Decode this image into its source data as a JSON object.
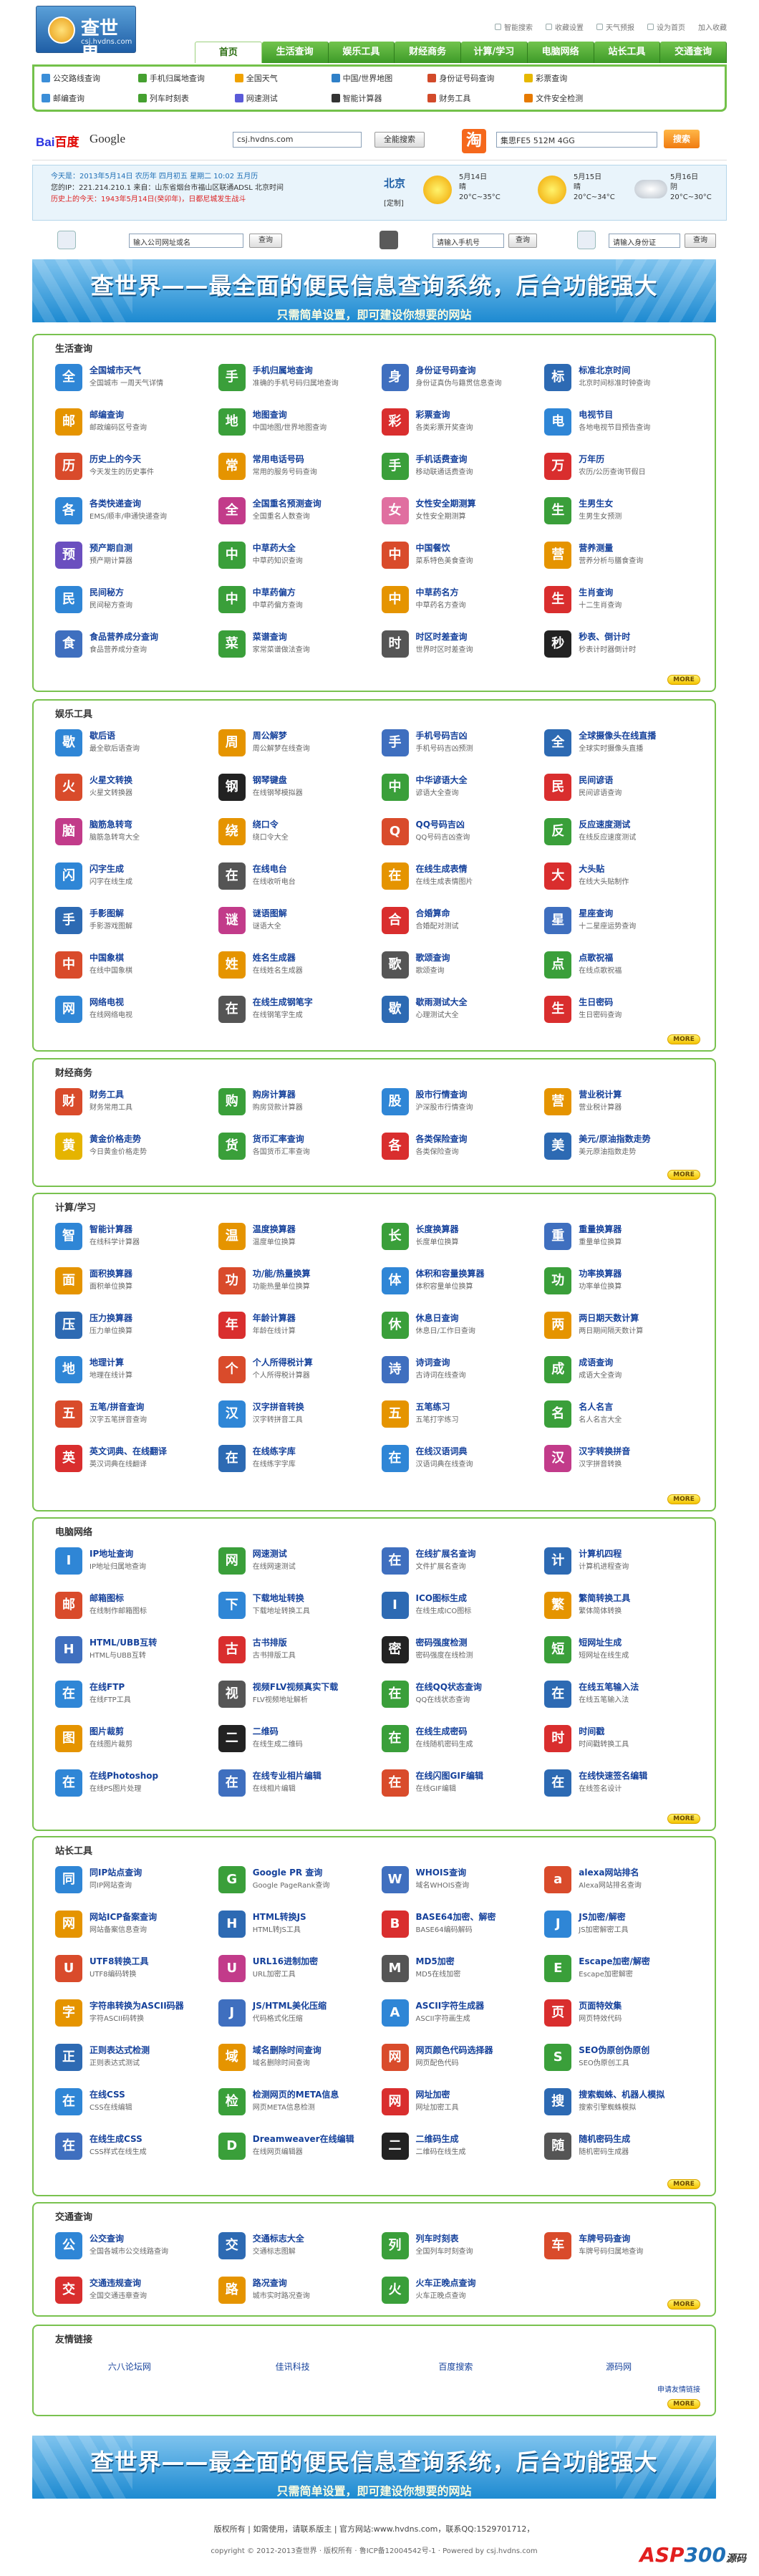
{
  "site": {
    "name": "查世界",
    "url": "csj.hvdns.com"
  },
  "toplinks": [
    "智能搜索",
    "收藏设置",
    "天气预报",
    "设为首页",
    "加入收藏"
  ],
  "nav": [
    "首页",
    "生活查询",
    "娱乐工具",
    "财经商务",
    "计算/学习",
    "电脑网络",
    "站长工具",
    "交通查询"
  ],
  "quick": [
    {
      "label": "公交路线查询",
      "color": "#3b8ed8"
    },
    {
      "label": "手机归属地查询",
      "color": "#45a030"
    },
    {
      "label": "全国天气",
      "color": "#f0a200"
    },
    {
      "label": "中国/世界地图",
      "color": "#2f80c8"
    },
    {
      "label": "身份证号码查询",
      "color": "#d24a2a"
    },
    {
      "label": "彩票查询",
      "color": "#e6b800"
    },
    {
      "label": "",
      "color": "#fff"
    },
    {
      "label": "邮编查询",
      "color": "#3b8ed8"
    },
    {
      "label": "列车时刻表",
      "color": "#45a030"
    },
    {
      "label": "网速测试",
      "color": "#5a5ad8"
    },
    {
      "label": "智能计算器",
      "color": "#333"
    },
    {
      "label": "财务工具",
      "color": "#d24a2a"
    },
    {
      "label": "文件安全检测",
      "color": "#e67a00"
    },
    {
      "label": "",
      "color": "#fff"
    }
  ],
  "search": {
    "baidu": "百度",
    "google": "Google",
    "query": "csj.hvdns.com",
    "button": "全能搜索",
    "taobao_icon": "淘",
    "taobao_value": "集思FE5 512M 4GG",
    "taobao_button": "搜索"
  },
  "info": {
    "line1": "今天是：2013年5月14日 农历年 四月初五 星期二 10:02 五月历",
    "line2": "您的IP：221.214.210.1 来自：山东省烟台市福山区联通ADSL 北京时间",
    "line3": "历史上的今天：1943年5月14日(癸卯年)，日都尼城发生战斗",
    "city": "北京",
    "city_set": "[定制]",
    "weather": [
      {
        "date": "5月14日",
        "cond": "晴",
        "temp": "20°C~35°C",
        "kind": "sun"
      },
      {
        "date": "5月15日",
        "cond": "晴",
        "temp": "20°C~34°C",
        "kind": "sun"
      },
      {
        "date": "5月16日",
        "cond": "阴",
        "temp": "20°C~30°C",
        "kind": "cloud"
      }
    ]
  },
  "sbar": {
    "ph1": "输入公司网址或名",
    "btn1": "查询",
    "ph2": "请输入手机号",
    "btn2": "查询",
    "ph3": "请输入身份证",
    "btn3": "查询"
  },
  "banner": {
    "title": "查世界——最全面的便民信息查询系统，后台功能强大",
    "sub": "只需简单设置，即可建设你想要的网站"
  },
  "more": "MORE",
  "sections": [
    {
      "title": "生活查询",
      "items": [
        [
          "全国城市天气",
          "全国城市 一周天气详情",
          "#2f86d6"
        ],
        [
          "手机归属地查询",
          "准确的手机号码归属地查询",
          "#3a9f3a"
        ],
        [
          "身份证号码查询",
          "身份证真伪与籍贯信息查询",
          "#3f6fbf"
        ],
        [
          "标准北京时间",
          "北京时间标准时钟查询",
          "#2d6ab3"
        ],
        [
          "邮编查询",
          "邮政编码区号查询",
          "#e59400"
        ],
        [
          "地图查询",
          "中国地图/世界地图查询",
          "#3a9f3a"
        ],
        [
          "彩票查询",
          "各类彩票开奖查询",
          "#d92e2e"
        ],
        [
          "电视节目",
          "各地电视节目预告查询",
          "#2f86d6"
        ],
        [
          "历史上的今天",
          "今天发生的历史事件",
          "#d94b2b"
        ],
        [
          "常用电话号码",
          "常用的服务号码查询",
          "#e59400"
        ],
        [
          "手机话费查询",
          "移动联通话费查询",
          "#3a9f3a"
        ],
        [
          "万年历",
          "农历/公历查询节假日",
          "#d92e2e"
        ],
        [
          "各类快递查询",
          "EMS/顺丰/申通快递查询",
          "#2f86d6"
        ],
        [
          "全国重名预测查询",
          "全国重名人数查询",
          "#c23b8a"
        ],
        [
          "女性安全期测算",
          "女性安全期测算",
          "#e06fa0"
        ],
        [
          "生男生女",
          "生男生女预测",
          "#3a9f3a"
        ],
        [
          "预产期自测",
          "预产期计算器",
          "#6b4fbf"
        ],
        [
          "中草药大全",
          "中草药知识查询",
          "#3a9f3a"
        ],
        [
          "中国餐饮",
          "菜系特色美食查询",
          "#d94b2b"
        ],
        [
          "营养测量",
          "营养分析与膳食查询",
          "#e59400"
        ],
        [
          "民间秘方",
          "民间秘方查询",
          "#2f86d6"
        ],
        [
          "中草药偏方",
          "中草药偏方查询",
          "#3a9f3a"
        ],
        [
          "中草药名方",
          "中草药名方查询",
          "#e59400"
        ],
        [
          "生肖查询",
          "十二生肖查询",
          "#d92e2e"
        ],
        [
          "食品营养成分查询",
          "食品营养成分查询",
          "#3f6fbf"
        ],
        [
          "菜谱查询",
          "家常菜谱做法查询",
          "#3a9f3a"
        ],
        [
          "时区时差查询",
          "世界时区时差查询",
          "#555555"
        ],
        [
          "秒表、倒计时",
          "秒表计时器倒计时",
          "#222222"
        ]
      ]
    },
    {
      "title": "娱乐工具",
      "items": [
        [
          "歇后语",
          "最全歇后语查询",
          "#2f86d6"
        ],
        [
          "周公解梦",
          "周公解梦在线查询",
          "#e59400"
        ],
        [
          "手机号码吉凶",
          "手机号码吉凶预测",
          "#3f6fbf"
        ],
        [
          "全球摄像头在线直播",
          "全球实时摄像头直播",
          "#2d6ab3"
        ],
        [
          "火星文转换",
          "火星文转换器",
          "#d94b2b"
        ],
        [
          "钢琴键盘",
          "在线钢琴模拟器",
          "#222222"
        ],
        [
          "中华谚语大全",
          "谚语大全查询",
          "#3a9f3a"
        ],
        [
          "民间谚语",
          "民间谚语查询",
          "#d92e2e"
        ],
        [
          "脑筋急转弯",
          "脑筋急转弯大全",
          "#c23b8a"
        ],
        [
          "绕口令",
          "绕口令大全",
          "#e59400"
        ],
        [
          "QQ号码吉凶",
          "QQ号码吉凶查询",
          "#d94b2b"
        ],
        [
          "反应速度测试",
          "在线反应速度测试",
          "#3a9f3a"
        ],
        [
          "闪字生成",
          "闪字在线生成",
          "#2f86d6"
        ],
        [
          "在线电台",
          "在线收听电台",
          "#555555"
        ],
        [
          "在线生成表情",
          "在线生成表情图片",
          "#e59400"
        ],
        [
          "大头贴",
          "在线大头贴制作",
          "#d92e2e"
        ],
        [
          "手影图解",
          "手影游戏图解",
          "#2d6ab3"
        ],
        [
          "谜语图解",
          "谜语大全",
          "#c23b8a"
        ],
        [
          "合婚算命",
          "合婚配对测试",
          "#d92e2e"
        ],
        [
          "星座查询",
          "十二星座运势查询",
          "#3f6fbf"
        ],
        [
          "中国象棋",
          "在线中国象棋",
          "#d94b2b"
        ],
        [
          "姓名生成器",
          "在线姓名生成器",
          "#e59400"
        ],
        [
          "歌颂查询",
          "歌颂查询",
          "#555555"
        ],
        [
          "点歌祝福",
          "在线点歌祝福",
          "#3a9f3a"
        ],
        [
          "网络电视",
          "在线网络电视",
          "#2f86d6"
        ],
        [
          "在线生成钢笔字",
          "在线钢笔字生成",
          "#555555"
        ],
        [
          "歇雨测试大全",
          "心理测试大全",
          "#2d6ab3"
        ],
        [
          "生日密码",
          "生日密码查询",
          "#d92e2e"
        ]
      ]
    },
    {
      "title": "财经商务",
      "items": [
        [
          "财务工具",
          "财务常用工具",
          "#d94b2b"
        ],
        [
          "购房计算器",
          "购房贷款计算器",
          "#3a9f3a"
        ],
        [
          "股市行情查询",
          "沪深股市行情查询",
          "#2f86d6"
        ],
        [
          "营业税计算",
          "营业税计算器",
          "#e59400"
        ],
        [
          "黄金价格走势",
          "今日黄金价格走势",
          "#e5b400"
        ],
        [
          "货币汇率查询",
          "各国货币汇率查询",
          "#3a9f3a"
        ],
        [
          "各类保险查询",
          "各类保险查询",
          "#d92e2e"
        ],
        [
          "美元/原油指数走势",
          "美元原油指数走势",
          "#2d6ab3"
        ]
      ]
    },
    {
      "title": "计算/学习",
      "items": [
        [
          "智能计算器",
          "在线科学计算器",
          "#2f86d6"
        ],
        [
          "温度换算器",
          "温度单位换算",
          "#e59400"
        ],
        [
          "长度换算器",
          "长度单位换算",
          "#3a9f3a"
        ],
        [
          "重量换算器",
          "重量单位换算",
          "#3f6fbf"
        ],
        [
          "面积换算器",
          "面积单位换算",
          "#e59400"
        ],
        [
          "功/能/热量换算",
          "功能热量单位换算",
          "#d94b2b"
        ],
        [
          "体积和容量换算器",
          "体积容量单位换算",
          "#2f86d6"
        ],
        [
          "功率换算器",
          "功率单位换算",
          "#3a9f3a"
        ],
        [
          "压力换算器",
          "压力单位换算",
          "#2d6ab3"
        ],
        [
          "年龄计算器",
          "年龄在线计算",
          "#d92e2e"
        ],
        [
          "休息日查询",
          "休息日/工作日查询",
          "#3a9f3a"
        ],
        [
          "两日期天数计算",
          "两日期间隔天数计算",
          "#e59400"
        ],
        [
          "地理计算",
          "地理在线计算",
          "#2f86d6"
        ],
        [
          "个人所得税计算",
          "个人所得税计算器",
          "#d94b2b"
        ],
        [
          "诗词查询",
          "古诗词在线查询",
          "#3f6fbf"
        ],
        [
          "成语查询",
          "成语大全查询",
          "#3a9f3a"
        ],
        [
          "五笔/拼音查询",
          "汉字五笔拼音查询",
          "#d94b2b"
        ],
        [
          "汉字拼音转换",
          "汉字转拼音工具",
          "#2f86d6"
        ],
        [
          "五笔练习",
          "五笔打字练习",
          "#e59400"
        ],
        [
          "名人名言",
          "名人名言大全",
          "#3a9f3a"
        ],
        [
          "英文词典、在线翻译",
          "英汉词典在线翻译",
          "#d92e2e"
        ],
        [
          "在线练字库",
          "在线练字字库",
          "#2d6ab3"
        ],
        [
          "在线汉语词典",
          "汉语词典在线查询",
          "#2f86d6"
        ],
        [
          "汉字转换拼音",
          "汉字拼音转换",
          "#c23b8a"
        ]
      ]
    },
    {
      "title": "电脑网络",
      "items": [
        [
          "IP地址查询",
          "IP地址归属地查询",
          "#2f86d6"
        ],
        [
          "网速测试",
          "在线网速测试",
          "#3a9f3a"
        ],
        [
          "在线扩展名查询",
          "文件扩展名查询",
          "#3f6fbf"
        ],
        [
          "计算机四程",
          "计算机进程查询",
          "#2d6ab3"
        ],
        [
          "邮箱图标",
          "在线制作邮箱图标",
          "#d94b2b"
        ],
        [
          "下载地址转换",
          "下载地址转换工具",
          "#2f86d6"
        ],
        [
          "ICO图标生成",
          "在线生成ICO图标",
          "#2d6ab3"
        ],
        [
          "繁简转换工具",
          "繁体简体转换",
          "#e59400"
        ],
        [
          "HTML/UBB互转",
          "HTML与UBB互转",
          "#3f6fbf"
        ],
        [
          "古书排版",
          "古书排版工具",
          "#d92e2e"
        ],
        [
          "密码强度检测",
          "密码强度在线检测",
          "#222222"
        ],
        [
          "短网址生成",
          "短网址在线生成",
          "#3a9f3a"
        ],
        [
          "在线FTP",
          "在线FTP工具",
          "#2f86d6"
        ],
        [
          "视频FLV视频真实下载",
          "FLV视频地址解析",
          "#555555"
        ],
        [
          "在线QQ状态查询",
          "QQ在线状态查询",
          "#3a9f3a"
        ],
        [
          "在线五笔输入法",
          "在线五笔输入法",
          "#2d6ab3"
        ],
        [
          "图片裁剪",
          "在线图片裁剪",
          "#e59400"
        ],
        [
          "二维码",
          "在线生成二维码",
          "#222222"
        ],
        [
          "在线生成密码",
          "在线随机密码生成",
          "#3a9f3a"
        ],
        [
          "时间戳",
          "时间戳转换工具",
          "#d92e2e"
        ],
        [
          "在线Photoshop",
          "在线PS图片处理",
          "#2f86d6"
        ],
        [
          "在线专业相片编辑",
          "在线相片编辑",
          "#3f6fbf"
        ],
        [
          "在线闪图GIF编辑",
          "在线GIF编辑",
          "#d94b2b"
        ],
        [
          "在线快速签名编辑",
          "在线签名设计",
          "#2d6ab3"
        ]
      ]
    },
    {
      "title": "站长工具",
      "items": [
        [
          "同IP站点查询",
          "同IP网站查询",
          "#2f86d6"
        ],
        [
          "Google PR 查询",
          "Google PageRank查询",
          "#3a9f3a"
        ],
        [
          "WHOIS查询",
          "域名WHOIS查询",
          "#3f6fbf"
        ],
        [
          "alexa网站排名",
          "Alexa网站排名查询",
          "#d94b2b"
        ],
        [
          "网站ICP备案查询",
          "网站备案信息查询",
          "#e59400"
        ],
        [
          "HTML转换JS",
          "HTML转JS工具",
          "#2d6ab3"
        ],
        [
          "BASE64加密、解密",
          "BASE64编码解码",
          "#d92e2e"
        ],
        [
          "JS加密/解密",
          "JS加密解密工具",
          "#2f86d6"
        ],
        [
          "UTF8转换工具",
          "UTF8编码转换",
          "#d94b2b"
        ],
        [
          "URL16进制加密",
          "URL加密工具",
          "#c23b8a"
        ],
        [
          "MD5加密",
          "MD5在线加密",
          "#555555"
        ],
        [
          "Escape加密/解密",
          "Escape加密解密",
          "#3a9f3a"
        ],
        [
          "字符串转换为ASCII码器",
          "字符ASCII码转换",
          "#e59400"
        ],
        [
          "JS/HTML美化压缩",
          "代码格式化压缩",
          "#3f6fbf"
        ],
        [
          "ASCII字符生成器",
          "ASCII字符画生成",
          "#2f86d6"
        ],
        [
          "页面特效集",
          "网页特效代码",
          "#d92e2e"
        ],
        [
          "正则表达式检测",
          "正则表达式测试",
          "#2d6ab3"
        ],
        [
          "域名删除时间查询",
          "域名删除时间查询",
          "#e59400"
        ],
        [
          "网页颜色代码选择器",
          "网页配色代码",
          "#d94b2b"
        ],
        [
          "SEO伪原创伪原创",
          "SEO伪原创工具",
          "#3a9f3a"
        ],
        [
          "在线CSS",
          "CSS在线编辑",
          "#2f86d6"
        ],
        [
          "检测网页的META信息",
          "网页META信息检测",
          "#3a9f3a"
        ],
        [
          "网址加密",
          "网址加密工具",
          "#d92e2e"
        ],
        [
          "搜索蜘蛛、机器人模拟",
          "搜索引擎蜘蛛模拟",
          "#2d6ab3"
        ],
        [
          "在线生成CSS",
          "CSS样式在线生成",
          "#3f6fbf"
        ],
        [
          "Dreamweaver在线编辑",
          "在线网页编辑器",
          "#3a9f3a"
        ],
        [
          "二维码生成",
          "二维码在线生成",
          "#222222"
        ],
        [
          "随机密码生成",
          "随机密码生成器",
          "#555555"
        ]
      ]
    },
    {
      "title": "交通查询",
      "items": [
        [
          "公交查询",
          "全国各城市公交线路查询",
          "#2f86d6"
        ],
        [
          "交通标志大全",
          "交通标志图解",
          "#2d6ab3"
        ],
        [
          "列车时刻表",
          "全国列车时刻查询",
          "#3a9f3a"
        ],
        [
          "车牌号码查询",
          "车牌号码归属地查询",
          "#d94b2b"
        ],
        [
          "交通违规查询",
          "全国交通违章查询",
          "#d92e2e"
        ],
        [
          "路况查询",
          "城市实时路况查询",
          "#e59400"
        ],
        [
          "火车正晚点查询",
          "火车正晚点查询",
          "#3a9f3a"
        ],
        [
          "",
          "",
          "#ffffff"
        ]
      ]
    }
  ],
  "links": {
    "title": "友情链接",
    "items": [
      "六八论坛网",
      "佳讯科技",
      "百度搜索",
      "源码网"
    ],
    "apply": "申请友情链接"
  },
  "footer": {
    "l1": "版权所有 | 如需使用，请联系版主 | 官方网站:www.hvdns.com，联系QQ:1529701712，",
    "l2a": "copyright © 2012-2013查世界 · 版权所有 · 鲁ICP备12004542号-1 · Powered by csj.hvdns.com",
    "wm1": "ASP",
    "wm2": "300",
    "wm3": "源码"
  }
}
